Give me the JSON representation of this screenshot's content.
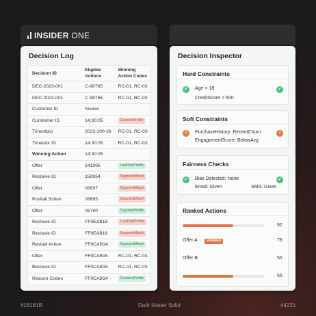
{
  "brand": {
    "name_bold": "INSIDER",
    "name_thin": " ONE"
  },
  "decision_log": {
    "title": "Decision Log",
    "columns": [
      "Decision ID",
      "Eligible Actions",
      "Winning Action Codes"
    ],
    "rows": [
      {
        "c1": "DEC-2023-001",
        "c2": "C-98765",
        "c3": "RC-01, RC-03",
        "bold": false
      },
      {
        "c1": "DEC-2023-001",
        "c2": "C-98765",
        "c3": "RC-01, RC-03",
        "bold": false
      },
      {
        "c1": "Customer ID",
        "c2": "Scores",
        "c3": "",
        "bold": false
      },
      {
        "c1": "Curstomer ID",
        "c2": "14:30:05",
        "tag": "CosmicrProfile",
        "tagColor": "red",
        "bold": false
      },
      {
        "c1": "Timesfprp",
        "c2": "2023-100-26",
        "c3": "RC-01, RC-03",
        "bold": false
      },
      {
        "c1": "Timestor ID",
        "c2": "14:30:05",
        "c3": "RC-01, RC-03",
        "bold": false
      },
      {
        "c1": "Winning Action",
        "c2": "14:30:05",
        "c3": "",
        "bold": true
      },
      {
        "c1": "Offer",
        "c2": "141005",
        "tag": "LowRiskProfile",
        "tagColor": "green",
        "bold": false
      },
      {
        "c1": "Resloive ID",
        "c2": "159954",
        "tag": "SegmentMatch",
        "tagColor": "red",
        "bold": false
      },
      {
        "c1": "Offer",
        "c2": "06697",
        "tag": "SegmentMatch",
        "tagColor": "red",
        "bold": false
      },
      {
        "c1": "Posltall Sction",
        "c2": "06695",
        "tag": "SegmentMatch",
        "tagColor": "red",
        "bold": false
      },
      {
        "c1": "Offer",
        "c2": "06790",
        "tag": "CegmiskProfile",
        "tagColor": "green",
        "bold": false
      },
      {
        "c1": "Reclovie ID",
        "c2": "FF0EAB18",
        "tag": "CowRiskProfile",
        "tagColor": "red",
        "bold": false
      },
      {
        "c1": "Reclovie ID",
        "c2": "FF0EAB18",
        "tag": "SegmentMatch",
        "tagColor": "red",
        "bold": false
      },
      {
        "c1": "Resltall Action",
        "c2": "FF0CAB14",
        "tag": "SegmentMetch",
        "tagColor": "green",
        "bold": false
      },
      {
        "c1": "Offer",
        "c2": "FF0CAB15",
        "c3": "RC-01, RC-03",
        "bold": false
      },
      {
        "c1": "Reclovie ID",
        "c2": "FF0CAB15",
        "c3": "RC-01, RC-03",
        "bold": false
      },
      {
        "c1": "Reason Codes",
        "c2": "FF0CAB14",
        "tag": "CosmicsProfile",
        "tagColor": "green",
        "bold": false
      }
    ]
  },
  "inspector": {
    "title": "Decision Inspector",
    "hard": {
      "title": "Hard Constraints",
      "line1": "Age > 18",
      "line2": "CreditScore > 600"
    },
    "soft": {
      "title": "Soft Constraints",
      "line1": "PurchaseHistory: RecentChurn",
      "line2": "EngagementScore: BelowAvg"
    },
    "fairness": {
      "title": "Fairness Checks",
      "line1": "Bias Detected: None",
      "line2a": "Email: Given",
      "line2b": "SMS: Given"
    },
    "ranked": {
      "title": "Ranked Actions",
      "badge": "WINNING",
      "items": [
        {
          "label": "",
          "score": "92",
          "bar": 0.62
        },
        {
          "label": "Offer A",
          "score": "78",
          "winning": true
        },
        {
          "label": "Offer B",
          "score": "55"
        },
        {
          "label": "",
          "score": "55",
          "bar": 0.62
        }
      ]
    }
  },
  "footer": {
    "left": "#18181B",
    "center": "Dark Matter Solid",
    "right": "44221"
  },
  "colors": {
    "accent": "#e07446",
    "ok": "#4fbf7f",
    "warn": "#e8763f",
    "background": "#18181B"
  }
}
